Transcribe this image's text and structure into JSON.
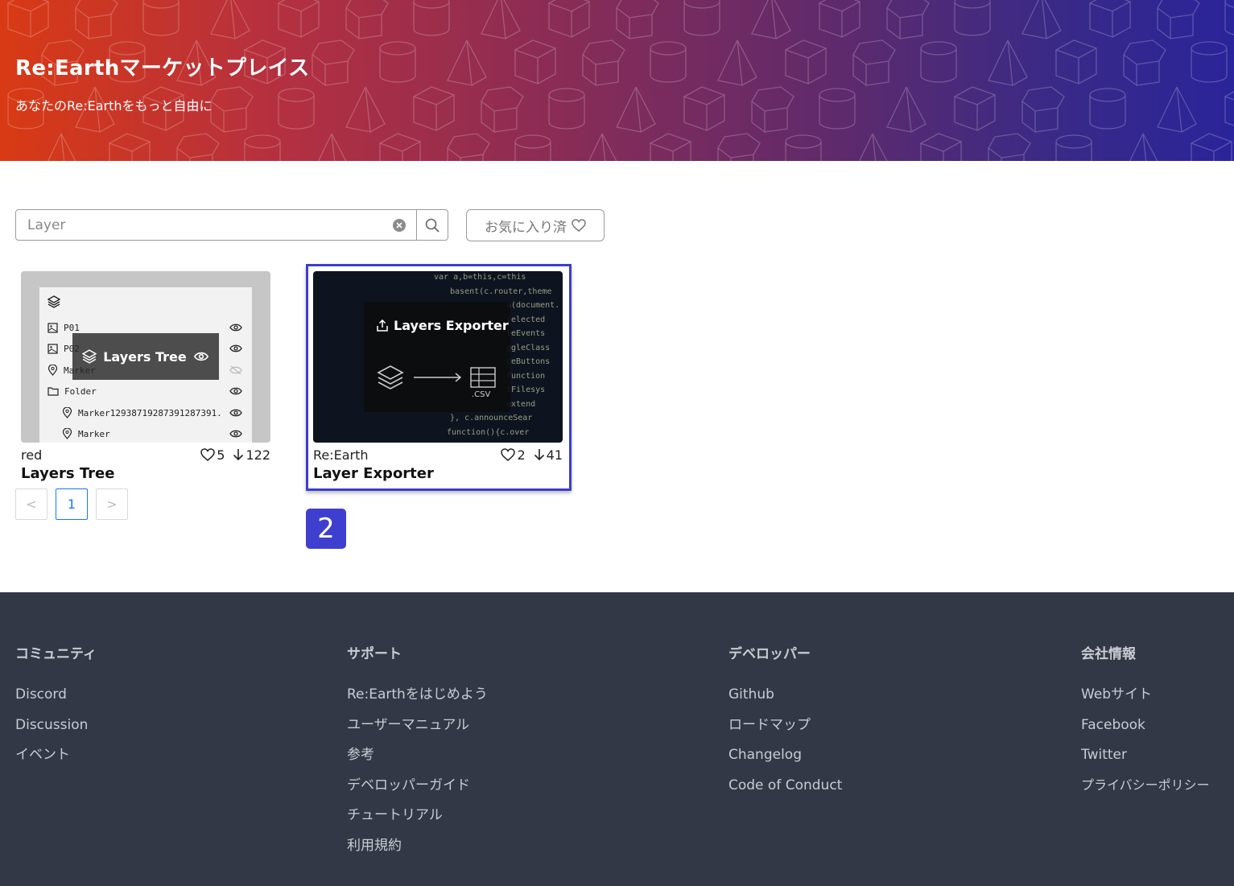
{
  "hero": {
    "title": "Re:Earthマーケットプレイス",
    "subtitle": "あなたのRe:Earthをもっと自由に"
  },
  "search": {
    "value": "Layer",
    "placeholder": "",
    "clear_icon": "close-circle-icon",
    "search_icon": "search-icon"
  },
  "favorites": {
    "label": "お気に入り済",
    "icon": "heart-outline-icon"
  },
  "cards": [
    {
      "author": "red",
      "title": "Layers Tree",
      "likes": "5",
      "downloads": "122",
      "overlay_label": "Layers Tree",
      "tree_items": [
        "P01",
        "P02",
        "Marker",
        "Folder",
        "Marker12938719287391287391...",
        "Marker"
      ]
    },
    {
      "author": "Re:Earth",
      "title": "Layer Exporter",
      "likes": "2",
      "downloads": "41",
      "overlay_label": "Layers Exporter",
      "csv_label": ".CSV",
      "code_lines": [
        "var a,b=this,c=this",
        "basent(c.router,theme",
        "a(document.",
        "selected",
        "teEvents",
        "ggleClass",
        "ceButtons",
        "function",
        "tFilesys",
        "extend",
        "}, c.announceSear",
        "function(){c.over"
      ]
    }
  ],
  "pagination": {
    "prev": "<",
    "current": "1",
    "next": ">"
  },
  "badge": "2",
  "footer": {
    "columns": [
      {
        "heading": "コミュニティ",
        "links": [
          "Discord",
          "Discussion",
          "イベント"
        ]
      },
      {
        "heading": "サポート",
        "links": [
          "Re:Earthをはじめよう",
          "ユーザーマニュアル",
          "参考",
          "デベロッパーガイド",
          "チュートリアル",
          "利用規約"
        ]
      },
      {
        "heading": "デベロッパー",
        "links": [
          "Github",
          "ロードマップ",
          "Changelog",
          "Code of Conduct"
        ]
      },
      {
        "heading": "会社情報",
        "links": [
          "Webサイト",
          "Facebook",
          "Twitter",
          "プライバシーポリシー"
        ]
      }
    ]
  }
}
